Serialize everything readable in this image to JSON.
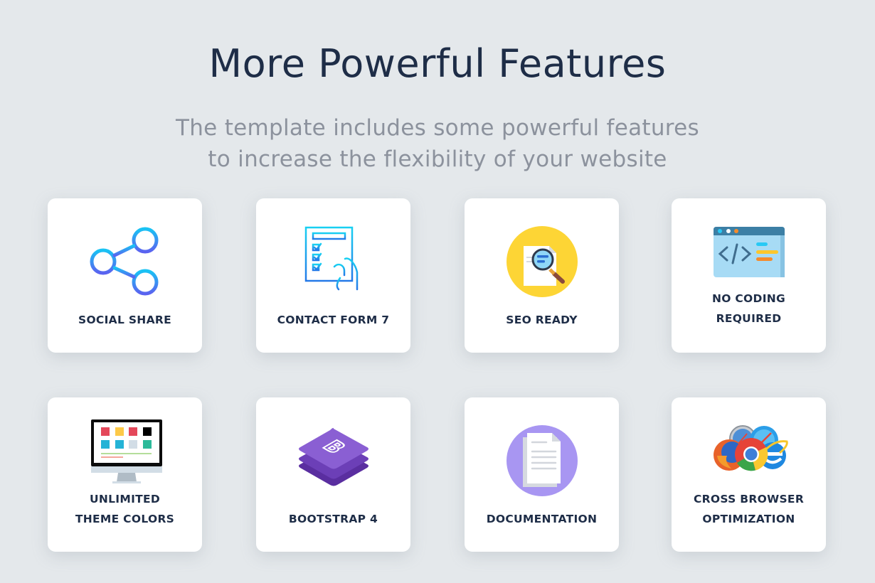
{
  "header": {
    "title": "More Powerful Features",
    "subtitle": "The template includes some powerful features\nto increase the flexibility of your website"
  },
  "features": [
    {
      "label": "SOCIAL SHARE",
      "icon": "share-icon"
    },
    {
      "label": "CONTACT FORM 7",
      "icon": "contact-form-icon"
    },
    {
      "label": "SEO READY",
      "icon": "seo-search-icon"
    },
    {
      "label": "NO CODING\nREQUIRED",
      "icon": "code-window-icon"
    },
    {
      "label": "UNLIMITED\nTHEME COLORS",
      "icon": "color-monitor-icon"
    },
    {
      "label": "BOOTSTRAP 4",
      "icon": "bootstrap-icon"
    },
    {
      "label": "DOCUMENTATION",
      "icon": "document-icon"
    },
    {
      "label": "CROSS BROWSER\nOPTIMIZATION",
      "icon": "browsers-icon"
    }
  ],
  "colors": {
    "background": "#e4e8eb",
    "title": "#1e2d47",
    "subtitle": "#8c929d",
    "card": "#ffffff"
  }
}
